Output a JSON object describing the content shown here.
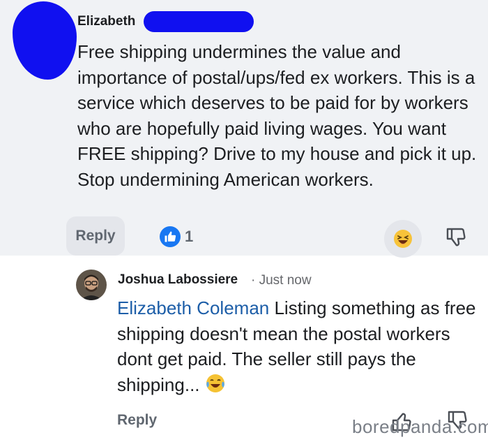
{
  "comment": {
    "author": "Elizabeth",
    "body": "Free shipping undermines the value and importance of postal/ups/fed ex workers. This is a service which deserves to be paid for by workers who are hopefully paid living wages. You want FREE shipping? Drive to my house and pick it up. Stop undermining American workers.",
    "reply_label": "Reply",
    "like_count": "1",
    "icons": {
      "like": "thumbs-up-icon",
      "reaction": "laughing-face-icon",
      "dislike": "thumbs-down-icon"
    },
    "colors": {
      "background": "#f0f2f5",
      "redaction": "#1010f0",
      "like": "#1877f2"
    }
  },
  "reply": {
    "author": "Joshua Labossiere",
    "time": "· Just now",
    "mention": "Elizabeth Coleman",
    "body": " Listing something as free shipping doesn't mean the postal workers dont get paid. The seller still pays the shipping... ",
    "reply_label": "Reply",
    "icons": {
      "avatar": "user-avatar",
      "emoji": "tears-of-joy-icon",
      "like": "thumbs-up-outline-icon",
      "dislike": "thumbs-down-icon"
    },
    "colors": {
      "mention": "#1d5ea8"
    }
  },
  "watermark": "boredpanda.com"
}
